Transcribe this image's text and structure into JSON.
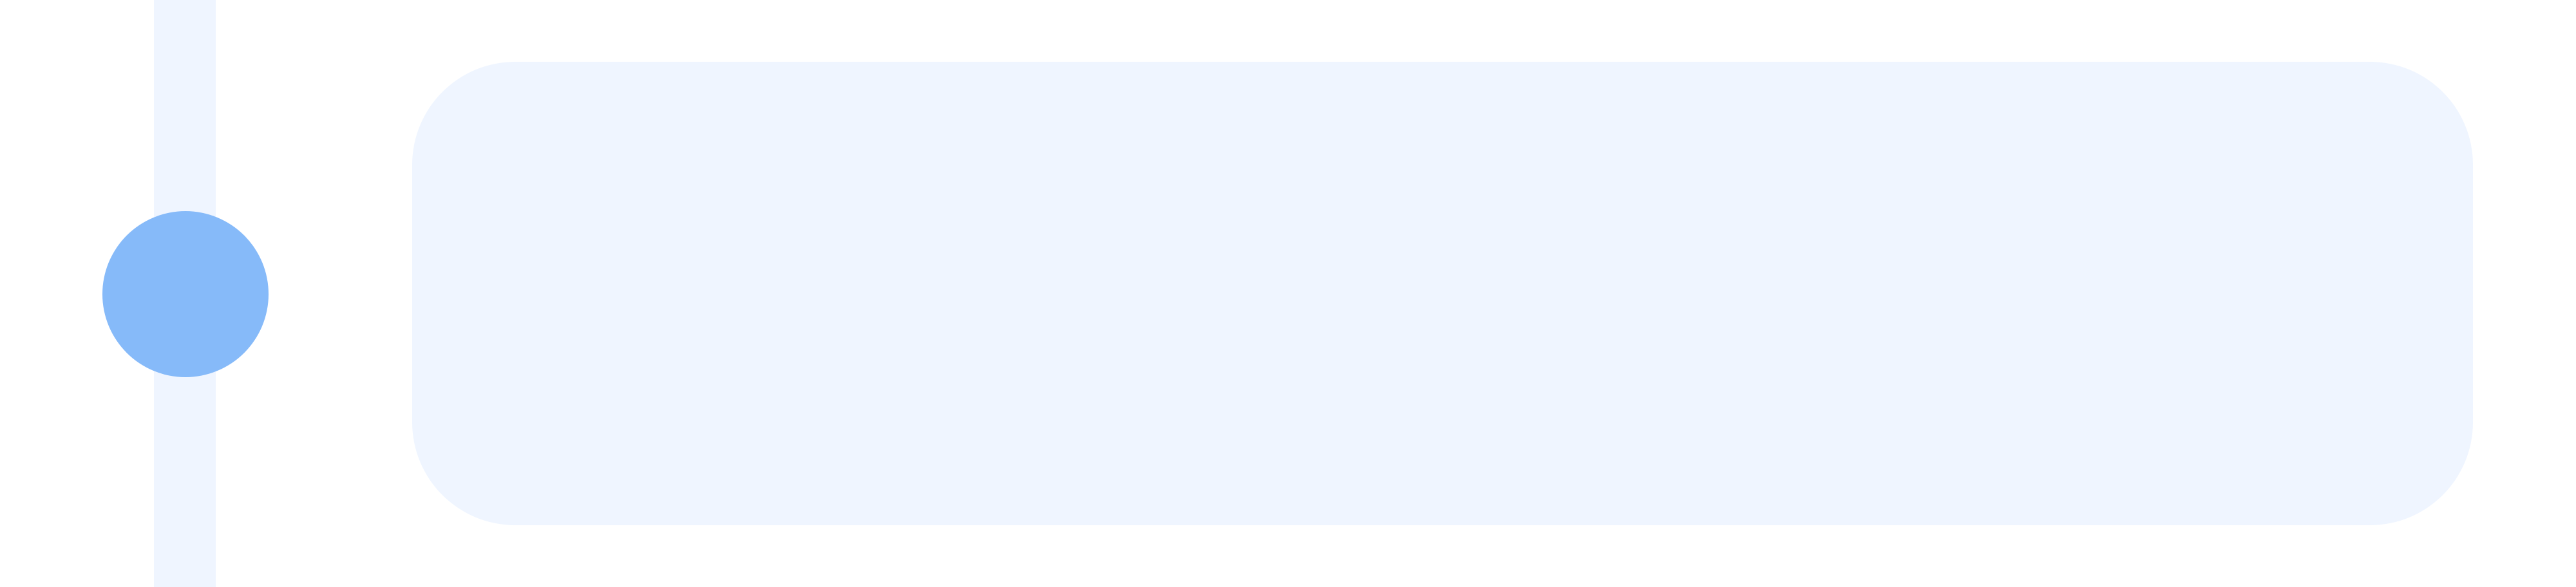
{
  "timeline": {
    "items": [
      {
        "title": "",
        "body": ""
      }
    ]
  },
  "colors": {
    "track": "#EFF5FF",
    "marker": "#86BAF9",
    "card": "#EFF5FF",
    "background": "#FFFFFF"
  }
}
